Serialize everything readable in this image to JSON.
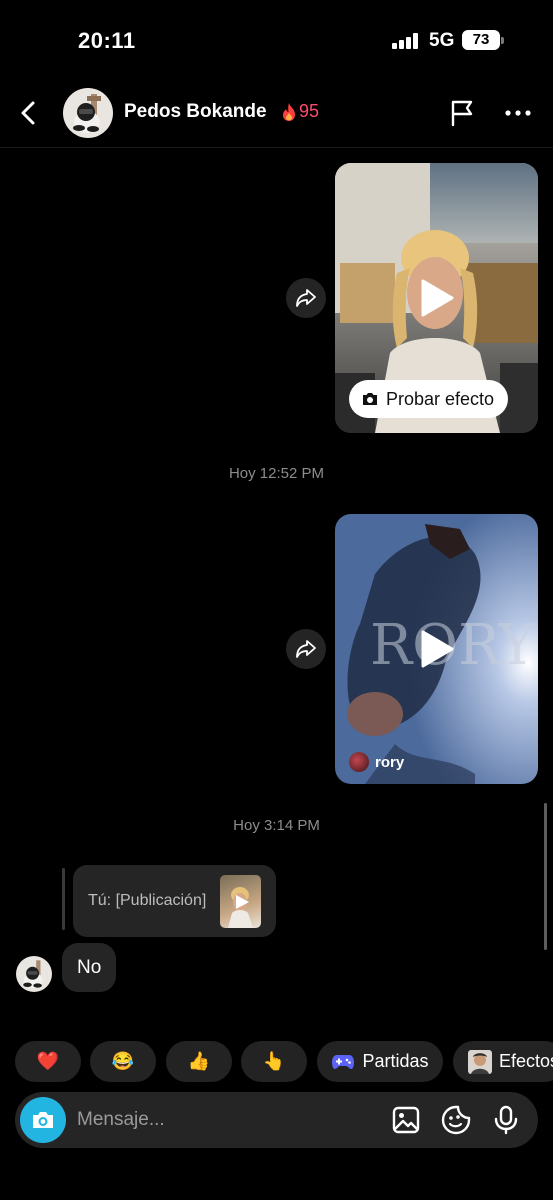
{
  "status_bar": {
    "time": "20:11",
    "network": "5G",
    "battery": "73"
  },
  "header": {
    "contact_name": "Pedos Bokande",
    "streak_count": "95",
    "icons": [
      "back-arrow-icon",
      "avatar",
      "flame-icon",
      "flag-icon",
      "more-icon"
    ]
  },
  "messages": {
    "video1": {
      "effect_button": "Probar efecto"
    },
    "timestamp1": "Hoy 12:52 PM",
    "video2": {
      "author": "rory",
      "overlay_text": "RORY"
    },
    "timestamp2": "Hoy 3:14 PM",
    "reply_preview": "Tú: [Publicación]",
    "reply_message": "No"
  },
  "quick_replies": {
    "heart": "❤️",
    "laugh": "😂",
    "thumbs_up": "👍",
    "point": "👆",
    "games_label": "Partidas",
    "effects_label": "Efectos"
  },
  "composer": {
    "placeholder": "Mensaje..."
  },
  "colors": {
    "background": "#000000",
    "bubble": "#252525",
    "accent_camera": "#23b5e1",
    "streak": "#ff4a6e",
    "games_icon": "#5b63f5"
  }
}
